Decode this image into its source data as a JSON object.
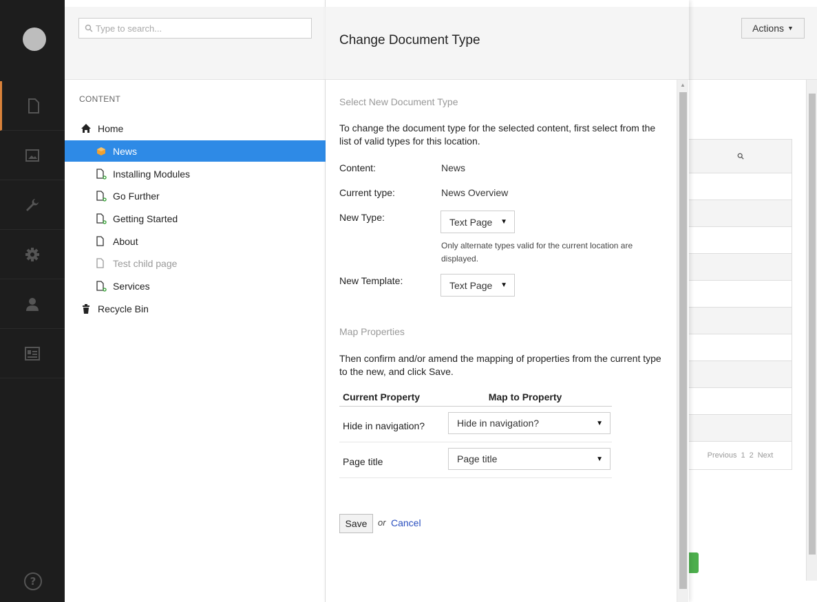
{
  "search": {
    "placeholder": "Type to search..."
  },
  "tree": {
    "section_label": "CONTENT",
    "items": [
      {
        "label": "Home",
        "icon": "home-icon"
      },
      {
        "label": "News",
        "icon": "news-box-icon"
      },
      {
        "label": "Installing Modules",
        "icon": "document-icon"
      },
      {
        "label": "Go Further",
        "icon": "document-icon"
      },
      {
        "label": "Getting Started",
        "icon": "document-icon"
      },
      {
        "label": "About",
        "icon": "document-icon"
      },
      {
        "label": "Test child page",
        "icon": "document-icon"
      },
      {
        "label": "Services",
        "icon": "document-icon"
      },
      {
        "label": "Recycle Bin",
        "icon": "trash-icon"
      }
    ]
  },
  "dialog": {
    "title": "Change Document Type",
    "select_section_title": "Select New Document Type",
    "intro": "To change the document type for the selected content, first select from the list of valid types for this location.",
    "content_label": "Content:",
    "content_value": "News",
    "current_type_label": "Current type:",
    "current_type_value": "News Overview",
    "new_type_label": "New Type:",
    "new_type_value": "Text Page",
    "new_type_hint": "Only alternate types valid for the current location are displayed.",
    "new_template_label": "New Template:",
    "new_template_value": "Text Page",
    "map_section_title": "Map Properties",
    "map_intro": "Then confirm and/or amend the mapping of properties from the current type to the new, and click Save.",
    "map_headers": {
      "current": "Current Property",
      "map_to": "Map to Property"
    },
    "map_rows": [
      {
        "current": "Hide in navigation?",
        "map_to": "Hide in navigation?"
      },
      {
        "current": "Page title",
        "map_to": "Page title"
      }
    ],
    "save_label": "Save",
    "or_text": "or",
    "cancel_label": "Cancel"
  },
  "background": {
    "actions_label": "Actions",
    "pager": {
      "previous": "Previous",
      "page1": "1",
      "page2": "2",
      "next": "Next"
    }
  },
  "colors": {
    "rail": "#1d1d1d",
    "rail_active_accent": "#d9823a",
    "selected_item": "#2e8ae6",
    "news_icon": "#f0a030",
    "doc_dot": "#2e9e2e",
    "green_button": "#4cae4c",
    "link": "#2a4fbf"
  }
}
